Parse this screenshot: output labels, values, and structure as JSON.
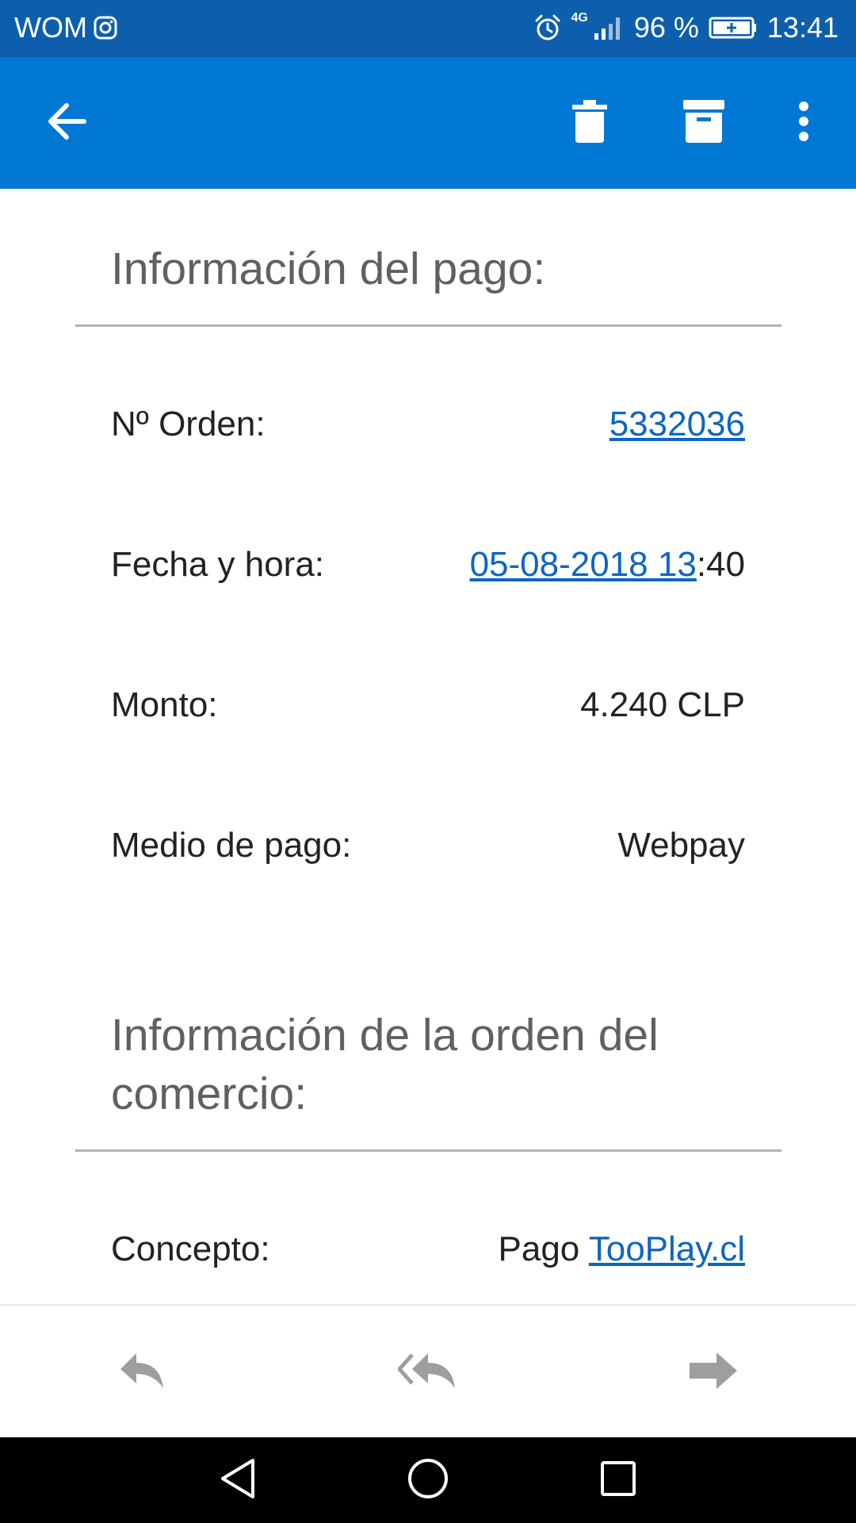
{
  "status_bar": {
    "carrier": "WOM",
    "network": "4G",
    "battery": "96 %",
    "time": "13:41"
  },
  "toolbar": {
    "icons": [
      "back-arrow-icon",
      "delete-icon",
      "archive-icon",
      "more-vert-icon"
    ]
  },
  "payment_info": {
    "title": "Información del pago:",
    "order_label": "Nº Orden:",
    "order_value": "5332036",
    "datetime_label": "Fecha y hora:",
    "datetime_link": "05-08-2018 13",
    "datetime_rest": ":40",
    "amount_label": "Monto:",
    "amount_value": "4.240 CLP",
    "method_label": "Medio de pago:",
    "method_value": "Webpay"
  },
  "merchant_info": {
    "title_line1": "Información de la orden del",
    "title_line2": "comercio:",
    "concept_label": "Concepto:",
    "concept_prefix": "Pago ",
    "concept_link": "TooPlay.cl"
  },
  "actions": [
    "reply-icon",
    "reply-all-icon",
    "forward-icon"
  ],
  "colors": {
    "status_bar": "#0d5fae",
    "app_bar": "#0078d4",
    "link": "#0c66c2",
    "heading": "#606060",
    "text": "#222222",
    "action_icon": "#9e9e9e"
  }
}
